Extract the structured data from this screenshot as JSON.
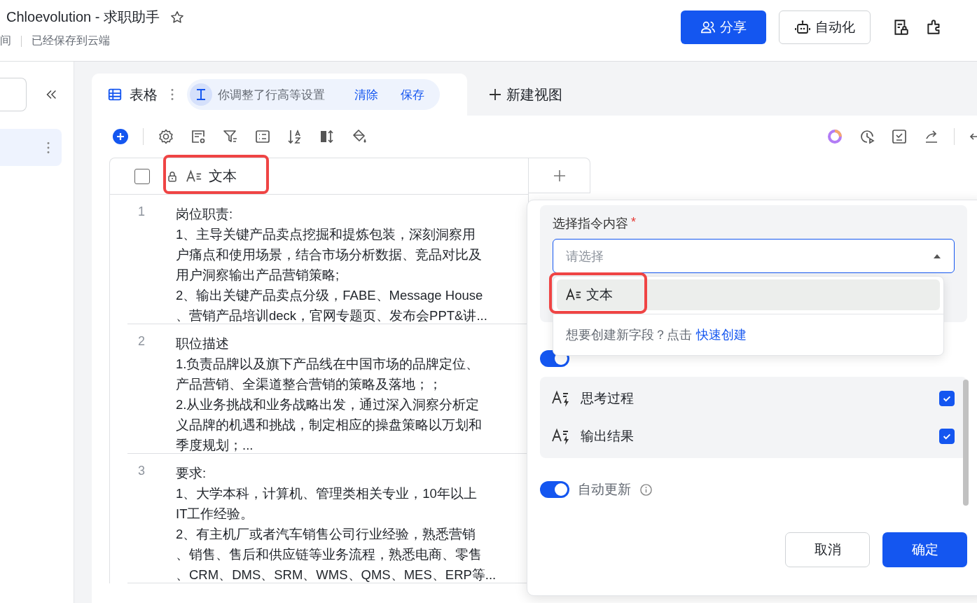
{
  "header": {
    "title": "Chloevolution - 求职助手",
    "location_cut": "间",
    "save_status": "已经保存到云端",
    "buttons": [
      {
        "label": "分享",
        "kind": "primary"
      },
      {
        "label": "自动化",
        "kind": "default"
      }
    ]
  },
  "sidebar": {
    "items": [
      {
        "selected": true
      }
    ]
  },
  "view_tabs": [
    {
      "label": "表格",
      "selected": true
    }
  ],
  "notice": {
    "text": "你调整了行高等设置",
    "actions": [
      "清除",
      "保存"
    ]
  },
  "new_view": "新建视图",
  "table": {
    "select_all": {
      "checked": false
    },
    "columns": [
      {
        "label": "文本"
      }
    ],
    "rows": [
      {
        "index": "1",
        "lines": [
          "岗位职责:",
          "1、主导关键产品卖点挖掘和提炼包装，深刻洞察用",
          "户痛点和使用场景，结合市场分析数据、竞品对比及",
          "用户洞察输出产品营销策略;",
          "2、输出关键产品卖点分级，FABE、Message House",
          "、营销产品培训deck，官网专题页、发布会PPT&讲..."
        ]
      },
      {
        "index": "2",
        "lines": [
          "职位描述",
          "1.负责品牌以及旗下产品线在中国市场的品牌定位、",
          "产品营销、全渠道整合营销的策略及落地；；",
          "2.从业务挑战和业务战略出发，通过深入洞察分析定",
          "义品牌的机遇和挑战，制定相应的操盘策略以万划和",
          "季度规划；..."
        ]
      },
      {
        "index": "3",
        "lines": [
          "要求:",
          "1、大学本科，计算机、管理类相关专业，10年以上",
          "IT工作经验。",
          "2、有主机厂或者汽车销售公司行业经验，熟悉营销",
          "、销售、售后和供应链等业务流程，熟悉电商、零售",
          "、CRM、DMS、SRM、WMS、QMS、MES、ERP等..."
        ]
      }
    ]
  },
  "panel": {
    "field_label": "选择指令内容",
    "required_mark": "*",
    "select": {
      "placeholder": "请选择",
      "open": true
    },
    "options": [
      {
        "label": "文本",
        "selected": true
      }
    ],
    "create_hint": "想要创建新字段？点击",
    "create_link": "快速创建",
    "more_info_toggle": {
      "on": true
    },
    "outputs": [
      {
        "label": "思考过程",
        "checked": true
      },
      {
        "label": "输出结果",
        "checked": true
      }
    ],
    "auto_update": {
      "label": "自动更新",
      "on": true
    },
    "buttons": [
      {
        "label": "取消",
        "kind": "default"
      },
      {
        "label": "确定",
        "kind": "primary"
      }
    ]
  }
}
